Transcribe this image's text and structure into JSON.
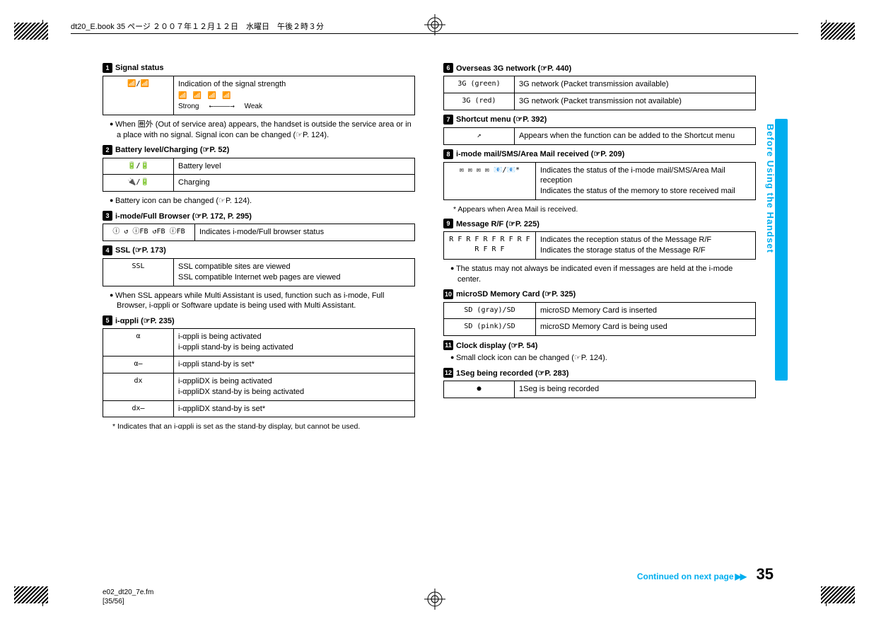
{
  "header": {
    "running": "dt20_E.book  35 ページ  ２００７年１２月１２日　水曜日　午後２時３分"
  },
  "side": {
    "tab_text": "Before Using the Handset"
  },
  "page": {
    "number": "35",
    "continued": "Continued on next page"
  },
  "footer": {
    "line1": "e02_dt20_7e.fm",
    "line2": "[35/56]"
  },
  "left": {
    "s1": {
      "title": "Signal status",
      "row1_icons": "📶/📶",
      "row1_desc_line1": "Indication of the signal strength",
      "strong": "Strong",
      "weak": "Weak",
      "bullet": "When 圏外 (Out of service area) appears, the handset is outside the service area or in a place with no signal. Signal icon can be changed (☞P. 124)."
    },
    "s2": {
      "title": "Battery level/Charging (☞P. 52)",
      "r1_icons": "🔋/🔋",
      "r1_desc": "Battery level",
      "r2_icons": "🔌/🔋",
      "r2_desc": "Charging",
      "bullet": "Battery icon can be changed (☞P. 124)."
    },
    "s3": {
      "title": "i-mode/Full Browser (☞P. 172, P. 295)",
      "icons": "ⓘ ↺ ⓘFB ↺FB ⓘFB",
      "desc": "Indicates i-mode/Full browser status"
    },
    "s4": {
      "title": "SSL (☞P. 173)",
      "icons": "SSL",
      "desc": "SSL compatible sites are viewed\nSSL compatible Internet web pages are viewed",
      "bullet": "When SSL appears while Multi Assistant is used, function such as i-mode, Full Browser, i-αppli or Software update is being used with Multi Assistant."
    },
    "s5": {
      "title": "i-αppli (☞P. 235)",
      "r1_i": "α",
      "r1_d": "i-αppli is being activated\ni-αppli stand-by is being activated",
      "r2_i": "α̶",
      "r2_d": "i-αppli stand-by is set*",
      "r3_i": "dx",
      "r3_d": "i-αppliDX is being activated\ni-αppliDX stand-by is being activated",
      "r4_i": "dx̶",
      "r4_d": "i-αppliDX stand-by is set*",
      "note": "* Indicates that an i-αppli is set as the stand-by display, but cannot be used."
    }
  },
  "right": {
    "s6": {
      "title": "Overseas 3G network (☞P. 440)",
      "r1_i": "3G (green)",
      "r1_d": "3G network (Packet transmission available)",
      "r2_i": "3G (red)",
      "r2_d": "3G network (Packet transmission not available)"
    },
    "s7": {
      "title": "Shortcut menu (☞P. 392)",
      "r1_i": "↗",
      "r1_d": "Appears when the function can be added to the Shortcut menu"
    },
    "s8": {
      "title": "i-mode mail/SMS/Area Mail received (☞P. 209)",
      "r1_i": "✉ ✉ ✉ ✉ 📧/📧*",
      "r1_d": "Indicates the status of the i-mode mail/SMS/Area Mail reception\nIndicates the status of the memory to store received mail",
      "note": "* Appears when Area Mail is received."
    },
    "s9": {
      "title": "Message R/F (☞P. 225)",
      "r1_i": "R F R F R F R F R F R F R F",
      "r1_d": "Indicates the reception status of the Message R/F\nIndicates the storage status of the Message R/F",
      "bullet": "The status may not always be indicated even if messages are held at the i-mode center."
    },
    "s10": {
      "title": "microSD Memory Card (☞P. 325)",
      "r1_i": "SD (gray)/SD",
      "r1_d": "microSD Memory Card is inserted",
      "r2_i": "SD (pink)/SD",
      "r2_d": "microSD Memory Card is being used"
    },
    "s11": {
      "title": "Clock display (☞P. 54)",
      "bullet": "Small clock icon can be changed (☞P. 124)."
    },
    "s12": {
      "title": "1Seg being recorded (☞P. 283)",
      "r1_i": "●",
      "r1_d": "1Seg is being recorded"
    }
  }
}
